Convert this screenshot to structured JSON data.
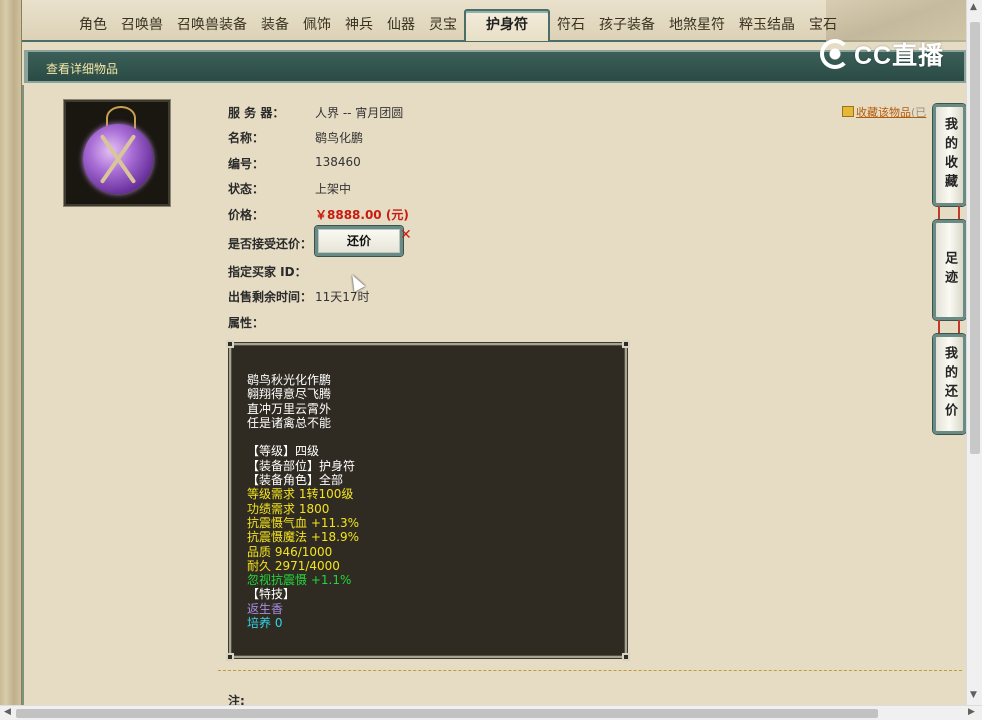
{
  "tabs": [
    {
      "label": "角色"
    },
    {
      "label": "召唤兽"
    },
    {
      "label": "召唤兽装备"
    },
    {
      "label": "装备"
    },
    {
      "label": "佩饰"
    },
    {
      "label": "神兵"
    },
    {
      "label": "仙器"
    },
    {
      "label": "灵宝"
    },
    {
      "label": "护身符",
      "active": true
    },
    {
      "label": "符石"
    },
    {
      "label": "孩子装备"
    },
    {
      "label": "地煞星符"
    },
    {
      "label": "粹玉结晶"
    },
    {
      "label": "宝石"
    }
  ],
  "overlay": {
    "logo_text": "CC直播"
  },
  "header": {
    "title": "查看详细物品"
  },
  "item": {
    "image_icon": "amulet-icon",
    "server_label": "服 务 器：",
    "server_value": "人界 -- 宵月团圆",
    "name_label": "名称：",
    "name_value": "鹖鸟化鹏",
    "number_label": "编号：",
    "number_value": "138460",
    "status_label": "状态：",
    "status_value": "上架中",
    "price_label": "价格：",
    "price_value": "￥8888.00 (元)",
    "accept_counter_label": "是否接受还价：",
    "counter_button": "还价",
    "buyer_label": "指定买家 ID：",
    "remaining_label": "出售剩余时间：",
    "remaining_value": "11天17时",
    "attrs_label": "属性："
  },
  "attributes": {
    "poem": [
      "鹖鸟秋光化作鹏",
      "翱翔得意尽飞腾",
      "直冲万里云霄外",
      "任是诸禽总不能"
    ],
    "base": [
      "【等级】四级",
      "【装备部位】护身符",
      "【装备角色】全部"
    ],
    "stats": [
      "等级需求 1转100级",
      "功绩需求 1800",
      "抗震慑气血 +11.3%",
      "抗震慑魔法 +18.9%",
      "品质 946/1000",
      "耐久 2971/4000"
    ],
    "green": "忽视抗震慑 +1.1%",
    "skill_label": "【特技】",
    "skill_value": "返生香",
    "nurture": "培养 0"
  },
  "favorite": {
    "label": "收藏该物品",
    "extra": "(已"
  },
  "side": [
    {
      "label": "我的收藏"
    },
    {
      "label": "足迹"
    },
    {
      "label": "我的还价"
    }
  ],
  "footer": {
    "note": "注:"
  },
  "colors": {
    "accent": "#2a4b45",
    "price": "#c81b10",
    "tooltip_bg": "#2f2b22"
  }
}
